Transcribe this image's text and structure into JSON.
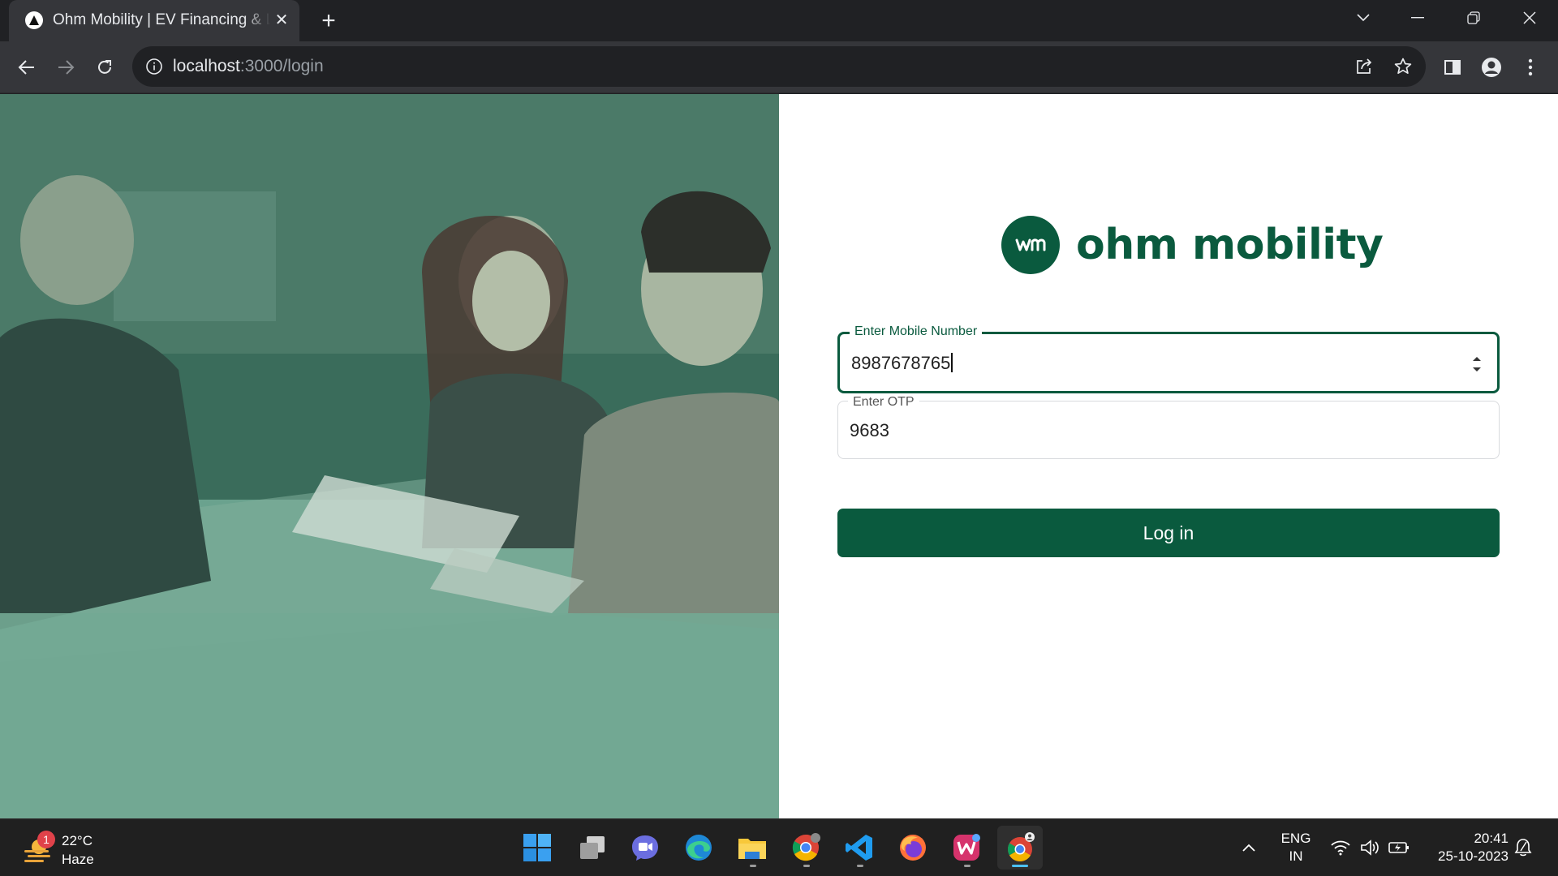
{
  "browser": {
    "tab_title": "Ohm Mobility | EV Financing & Leasing",
    "tab_close": "✕",
    "new_tab": "+",
    "url_host": "localhost",
    "url_path": ":3000/login"
  },
  "page": {
    "brand_name": "ohm mobility",
    "brand_mark_text": "ᴡᴍ",
    "mobile_label": "Enter Mobile Number",
    "mobile_value": "8987678765",
    "otp_label": "Enter OTP",
    "otp_value": "9683",
    "login_label": "Log in",
    "accent_color": "#0a5a3e"
  },
  "taskbar": {
    "weather_badge": "1",
    "temperature": "22°C",
    "condition": "Haze",
    "language_line1": "ENG",
    "language_line2": "IN",
    "time": "20:41",
    "date": "25-10-2023",
    "apps": [
      "start-icon",
      "task-view-icon",
      "chat-icon",
      "edge-icon",
      "file-explorer-icon",
      "chrome-icon",
      "vscode-icon",
      "firefox-icon",
      "wps-icon",
      "chrome-profile-icon"
    ]
  }
}
